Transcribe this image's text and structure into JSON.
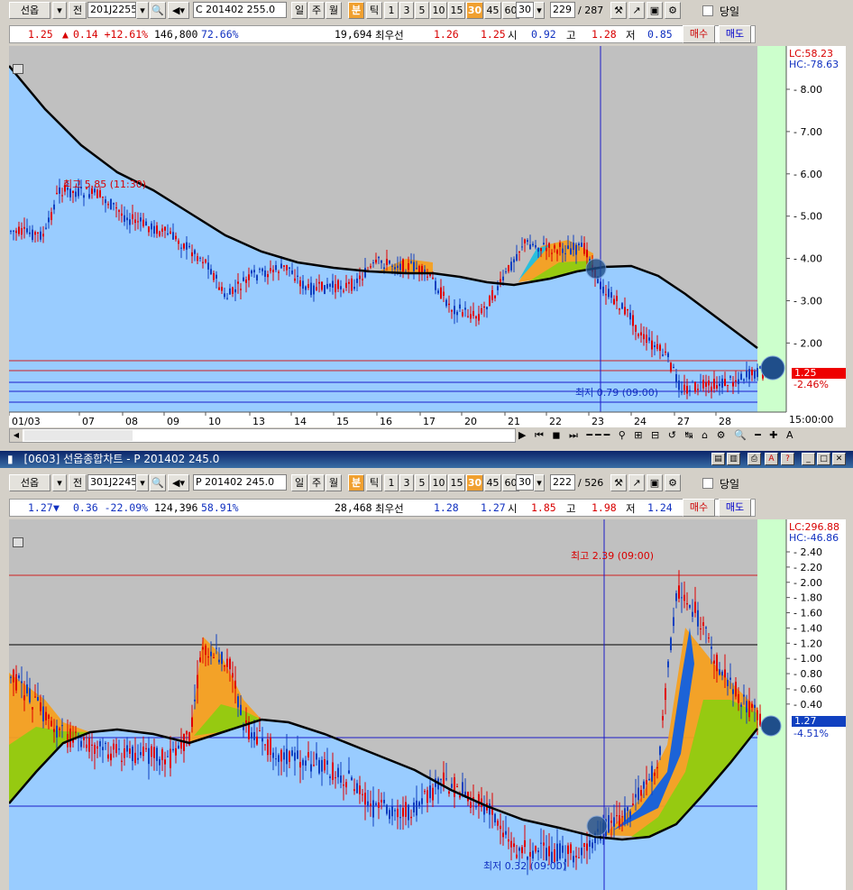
{
  "top": {
    "toolbar": {
      "market_select": "선옵",
      "prefix": "전",
      "code": "201J2255",
      "name": "C 201402 255.0",
      "periods": [
        "일",
        "주",
        "월"
      ],
      "active_period": "분",
      "tick_label": "틱",
      "minutes": [
        "1",
        "3",
        "5",
        "10",
        "15",
        "30",
        "45",
        "60"
      ],
      "selected_minute": "30",
      "minute_value": "30",
      "count": "229",
      "total": "/ 287",
      "same_day_label": "당일"
    },
    "info": {
      "price": "1.25",
      "arrow": "▲",
      "change": "0.14 +12.61%",
      "volume": "146,800",
      "ratio": "72.66%",
      "open_interest": "19,694",
      "best_label": "최우선",
      "ask": "1.26",
      "bid": "1.25",
      "open_label": "시",
      "open": "0.92",
      "high_label": "고",
      "high": "1.28",
      "low_label": "저",
      "low": "0.85",
      "buy": "매수",
      "sell": "매도"
    },
    "chart": {
      "lc": "LC:58.23",
      "hc": "HC:-78.63",
      "y_ticks": [
        "8.00",
        "7.00",
        "6.00",
        "5.00",
        "4.00",
        "3.00",
        "2.00"
      ],
      "current_price": "1.25",
      "current_pct": "-2.46%",
      "high_note": "최고 5.85 (11:30)",
      "low_note": "최저 0.79 (09:00)",
      "x_ticks": [
        "01/03",
        "07",
        "08",
        "09",
        "10",
        "13",
        "14",
        "15",
        "16",
        "17",
        "20",
        "21",
        "22",
        "23",
        "24",
        "27",
        "28"
      ],
      "time_label": "15:00:00"
    }
  },
  "bottom": {
    "title": "[0603] 선옵종합차트 - P 201402 245.0",
    "toolbar": {
      "market_select": "선옵",
      "prefix": "전",
      "code": "301J2245",
      "name": "P 201402 245.0",
      "periods": [
        "일",
        "주",
        "월"
      ],
      "active_period": "분",
      "tick_label": "틱",
      "minutes": [
        "1",
        "3",
        "5",
        "10",
        "15",
        "30",
        "45",
        "60"
      ],
      "selected_minute": "30",
      "minute_value": "30",
      "count": "222",
      "total": "/ 526",
      "same_day_label": "당일"
    },
    "info": {
      "price": "1.27",
      "arrow": "▼",
      "change": "0.36 -22.09%",
      "volume": "124,396",
      "ratio": "58.91%",
      "open_interest": "28,468",
      "best_label": "최우선",
      "ask": "1.28",
      "bid": "1.27",
      "open_label": "시",
      "open": "1.85",
      "high_label": "고",
      "high": "1.98",
      "low_label": "저",
      "low": "1.24",
      "buy": "매수",
      "sell": "매도"
    },
    "chart": {
      "lc": "LC:296.88",
      "hc": "HC:-46.86",
      "y_ticks": [
        "2.40",
        "2.20",
        "2.00",
        "1.80",
        "1.60",
        "1.40",
        "1.20",
        "1.00",
        "0.80",
        "0.60",
        "0.40"
      ],
      "current_price": "1.27",
      "current_pct": "-4.51%",
      "high_note": "최고 2.39 (09:00)",
      "low_note": "최저 0.32 (09:00)"
    }
  },
  "colors": {
    "chart_bg": "#99ccff",
    "cloud_bg": "#c0c0c0",
    "future_bg": "#ccffcc",
    "up": "#e00000",
    "down": "#1040c0"
  }
}
